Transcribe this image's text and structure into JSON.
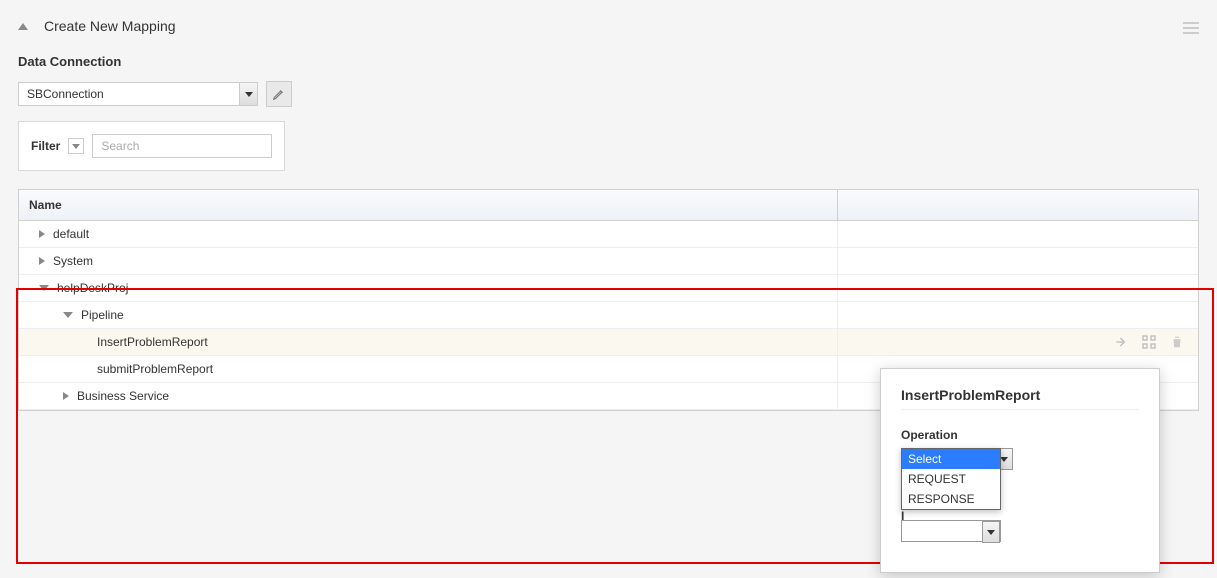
{
  "header": {
    "title": "Create New Mapping"
  },
  "data_connection": {
    "label": "Data Connection",
    "selected": "SBConnection"
  },
  "filter": {
    "label": "Filter",
    "placeholder": "Search",
    "value": ""
  },
  "table": {
    "columns": {
      "name": "Name"
    },
    "rows": [
      {
        "label": "default",
        "level": 0,
        "expanded": false,
        "selected": false
      },
      {
        "label": "System",
        "level": 0,
        "expanded": false,
        "selected": false
      },
      {
        "label": "helpDeskProj",
        "level": 0,
        "expanded": true,
        "selected": false
      },
      {
        "label": "Pipeline",
        "level": 1,
        "expanded": true,
        "selected": false
      },
      {
        "label": "InsertProblemReport",
        "level": 2,
        "expanded": null,
        "selected": true
      },
      {
        "label": "submitProblemReport",
        "level": 2,
        "expanded": null,
        "selected": false
      },
      {
        "label": "Business Service",
        "level": 1,
        "expanded": false,
        "selected": false
      }
    ]
  },
  "popup": {
    "title": "InsertProblemReport",
    "operation_label": "Operation",
    "operation_options": [
      "Select",
      "REQUEST",
      "RESPONSE"
    ],
    "operation_selected": "Select",
    "hidden_field_label_prefix": "I"
  }
}
